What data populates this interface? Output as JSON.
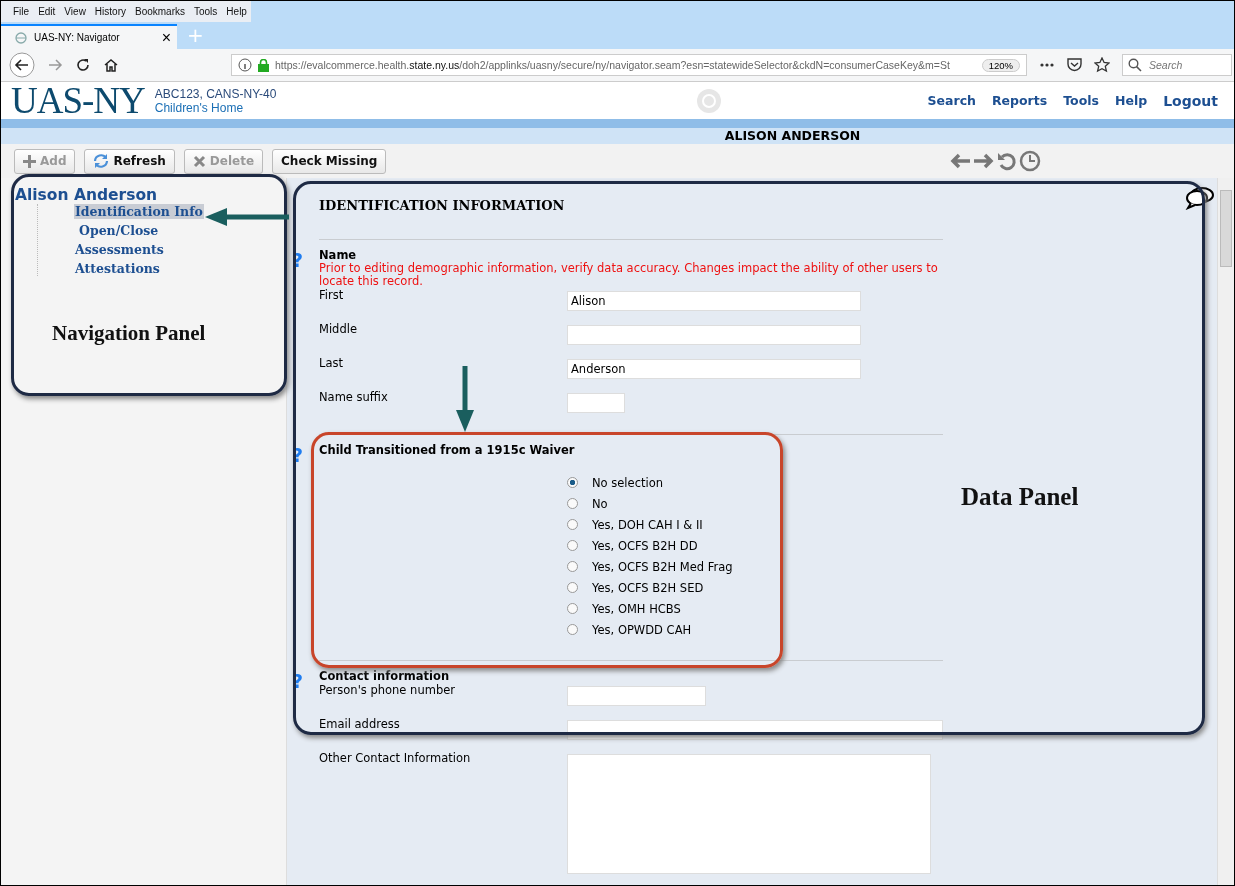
{
  "menu_bar": [
    "File",
    "Edit",
    "View",
    "History",
    "Bookmarks",
    "Tools",
    "Help"
  ],
  "browser_tab": {
    "title": "UAS-NY: Navigator",
    "close": "×",
    "new_tab": "+"
  },
  "address_bar": {
    "url_start": "https://evalcommerce.health.",
    "url_domain": "state.ny.us",
    "url_rest": "/doh2/applinks/uasny/secure/ny/navigator.seam?esn=statewideSelector&ckdN=consumerCaseKey&m=St",
    "zoom": "120%",
    "search_placeholder": "Search"
  },
  "header": {
    "logo": "UAS-NY",
    "org_code": "ABC123, CANS-NY-40",
    "org_name": "Children's Home",
    "nav": [
      "Search",
      "Reports",
      "Tools",
      "Help",
      "Logout"
    ]
  },
  "person_bar": {
    "name": "ALISON ANDERSON"
  },
  "toolbar": [
    {
      "label": "Add",
      "disabled": true
    },
    {
      "label": "Refresh",
      "disabled": false
    },
    {
      "label": "Delete",
      "disabled": true
    },
    {
      "label": "Check Missing",
      "disabled": false
    }
  ],
  "tree": {
    "root": "Alison Anderson",
    "children": [
      {
        "label": "Identification Info",
        "selected": true
      },
      {
        "label": "Open/Close",
        "selected": false
      },
      {
        "label": "Assessments",
        "selected": false
      },
      {
        "label": "Attestations",
        "selected": false
      }
    ]
  },
  "form": {
    "title": "IDENTIFICATION INFORMATION",
    "name_section": {
      "heading": "Name",
      "warning": "Prior to editing demographic information, verify data accuracy. Changes impact the ability of other users to locate this record.",
      "fields": [
        {
          "label": "First",
          "value": "Alison"
        },
        {
          "label": "Middle"
        },
        {
          "label": "Last",
          "value": "Anderson"
        },
        {
          "label": "Name suffix"
        }
      ]
    },
    "waiver_section": {
      "heading": "Child Transitioned from a 1915c Waiver",
      "options": [
        {
          "label": "No selection",
          "selected": true
        },
        {
          "label": "No",
          "selected": false
        },
        {
          "label": "Yes, DOH CAH I & II",
          "selected": false
        },
        {
          "label": "Yes, OCFS B2H DD",
          "selected": false
        },
        {
          "label": "Yes, OCFS B2H Med Frag",
          "selected": false
        },
        {
          "label": "Yes, OCFS B2H SED",
          "selected": false
        },
        {
          "label": "Yes, OMH HCBS",
          "selected": false
        },
        {
          "label": "Yes, OPWDD CAH",
          "selected": false
        }
      ]
    },
    "contact_section": {
      "heading": "Contact information",
      "fields": [
        {
          "label": "Person's phone number",
          "kind": "text"
        },
        {
          "label": "Email address",
          "kind": "text"
        },
        {
          "label": "Other Contact Information",
          "kind": "textarea"
        }
      ]
    },
    "help_mark": "?"
  },
  "annotations": {
    "navigation_label": "Navigation Panel",
    "data_label": "Data Panel"
  }
}
